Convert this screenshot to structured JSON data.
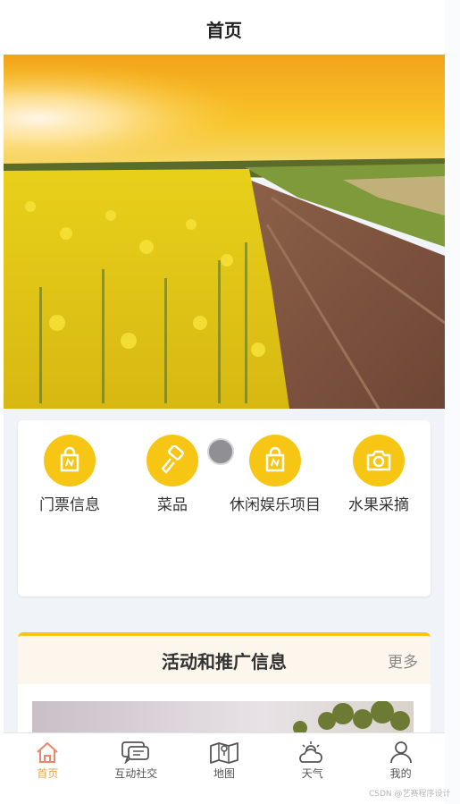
{
  "header": {
    "title": "首页"
  },
  "banner": {
    "image": "rapeseed-field-photo"
  },
  "menu": {
    "items": [
      {
        "label": "门票信息",
        "icon": "ticket-bag-icon"
      },
      {
        "label": "菜品",
        "icon": "brush-icon"
      },
      {
        "label": "休闲娱乐项目",
        "icon": "leisure-bag-icon"
      },
      {
        "label": "水果采摘",
        "icon": "camera-icon"
      }
    ]
  },
  "promo": {
    "title": "活动和推广信息",
    "more": "更多"
  },
  "tabbar": {
    "items": [
      {
        "label": "首页",
        "icon": "home-icon",
        "active": true
      },
      {
        "label": "互动社交",
        "icon": "chat-icon",
        "active": false
      },
      {
        "label": "地图",
        "icon": "map-icon",
        "active": false
      },
      {
        "label": "天气",
        "icon": "weather-icon",
        "active": false
      },
      {
        "label": "我的",
        "icon": "user-icon",
        "active": false
      }
    ]
  },
  "watermark": "CSDN @艺赛程序设计",
  "colors": {
    "accent": "#f7c614",
    "active_tab": "#e8a53a"
  }
}
